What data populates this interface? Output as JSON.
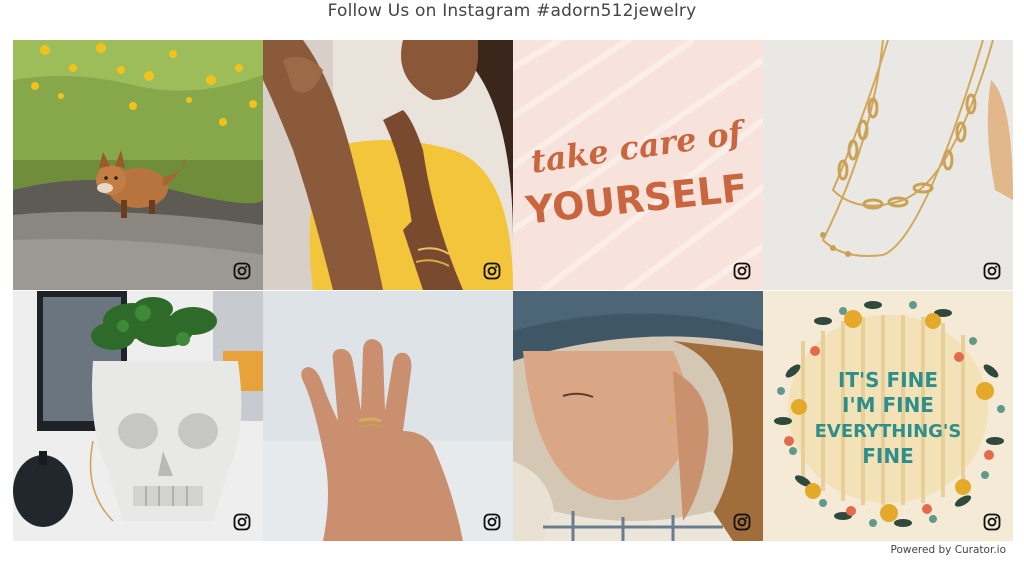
{
  "feed": {
    "title": "Follow Us on Instagram #adorn512jewelry",
    "posts": [
      {
        "subject": "fox kit on path",
        "icon": "instagram-icon"
      },
      {
        "subject": "woman wearing gold bracelets",
        "icon": "instagram-icon"
      },
      {
        "subject": "lettering graphic",
        "icon": "instagram-icon",
        "line1": "take care of",
        "line2": "YOURSELF"
      },
      {
        "subject": "layered gold chain necklaces",
        "icon": "instagram-icon"
      },
      {
        "subject": "skull planter with greenery",
        "icon": "instagram-icon"
      },
      {
        "subject": "hand wearing thin gold ring",
        "icon": "instagram-icon"
      },
      {
        "subject": "woman in hat with earrings",
        "icon": "instagram-icon"
      },
      {
        "subject": "floral wreath graphic",
        "icon": "instagram-icon",
        "line1": "IT'S FINE",
        "line2": "I'M FINE",
        "line3": "EVERYTHING'S",
        "line4": "FINE"
      }
    ]
  },
  "footer": {
    "powered_prefix": "Powered by ",
    "powered_link": "Curator.io"
  }
}
